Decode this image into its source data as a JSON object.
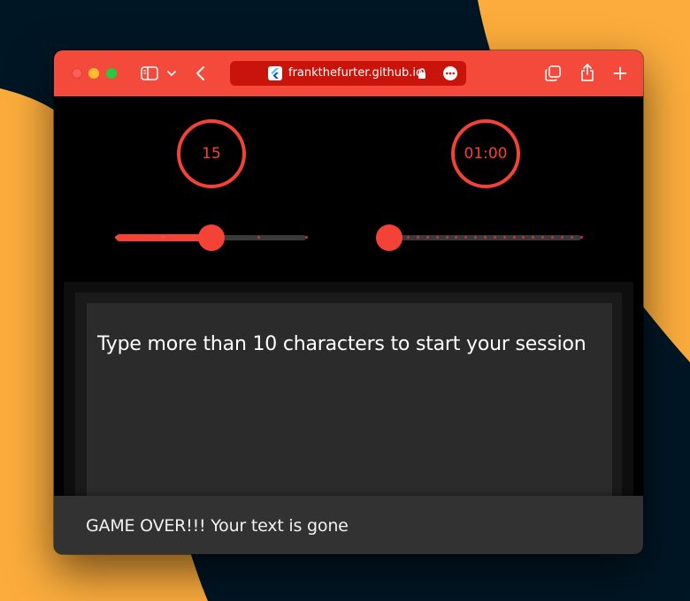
{
  "browser": {
    "url": "frankthefurter.github.io",
    "toolbar_color": "#f44a3b",
    "address_bar_color": "#c9140b",
    "icons": [
      "sidebar-icon",
      "chevron-down-icon",
      "back-icon",
      "flutter-favicon",
      "lock-icon",
      "more-icon",
      "tabs-overview-icon",
      "share-icon",
      "new-tab-icon"
    ]
  },
  "app": {
    "accent_color": "#f44336",
    "character_counter": {
      "value": "15"
    },
    "timer": {
      "value": "01:00"
    },
    "left_slider": {
      "level": 0.5,
      "stops": 5
    },
    "right_slider": {
      "level": 0.0,
      "stops": 21
    },
    "editor": {
      "text": "Type more than 10 characters to start your session"
    },
    "snackbar": {
      "message": "GAME OVER!!! Your text is gone"
    }
  }
}
